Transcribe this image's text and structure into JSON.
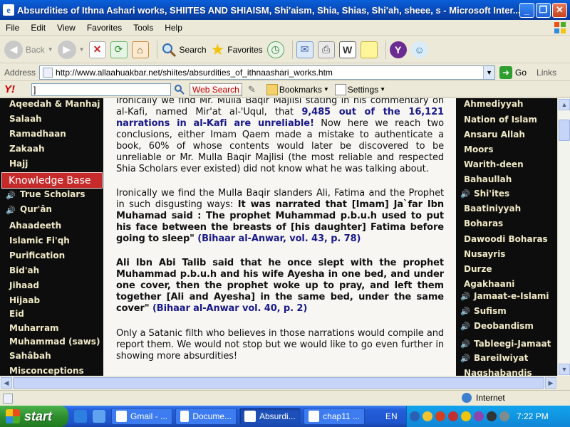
{
  "window": {
    "title": "Absurdities of Ithna Ashari works, SHIITES AND SHIAISM, Shi'aism, Shia, Shias, Shi'ah, sheee, s - Microsoft Inter..."
  },
  "menu": [
    "File",
    "Edit",
    "View",
    "Favorites",
    "Tools",
    "Help"
  ],
  "toolbar": {
    "back": "Back",
    "search": "Search",
    "favorites": "Favorites"
  },
  "address": {
    "label": "Address",
    "url": "http://www.allaahuakbar.net/shiites/absurdities_of_ithnaashari_works.htm",
    "go": "Go",
    "links": "Links"
  },
  "yahoo": {
    "logo": "Y!",
    "query": "]",
    "search_button": "Web Search",
    "bookmarks": "Bookmarks",
    "settings": "Settings"
  },
  "left_nav": [
    {
      "label": "Aqeedah & Manhaj",
      "sound": false
    },
    {
      "label": "Salaah",
      "sound": false
    },
    {
      "label": "Ramadhaan",
      "sound": false
    },
    {
      "label": "Zakaah",
      "sound": false
    },
    {
      "label": "Hajj",
      "sound": false
    },
    {
      "label": "Knowledge Base",
      "highlight": true
    },
    {
      "label": "True Scholars",
      "sound": true
    },
    {
      "label": "Qur'ân",
      "sound": true
    },
    {
      "label": "Ahaadeeth",
      "sound": false
    },
    {
      "label": "Islamic Fi'qh",
      "sound": false
    },
    {
      "label": "Purification",
      "sound": false
    },
    {
      "label": "Bid'ah",
      "sound": false
    },
    {
      "label": "Jihaad",
      "sound": false
    },
    {
      "label": "Hijaab",
      "sound": false
    },
    {
      "label": "Eid",
      "sound": false
    },
    {
      "label": "Muharram",
      "sound": false
    },
    {
      "label": "Muhammad (saws)",
      "sound": false
    },
    {
      "label": "Sahâbah",
      "sound": false
    },
    {
      "label": "Misconceptions",
      "sound": false
    }
  ],
  "right_nav": [
    {
      "label": "Ahmediyyah",
      "sound": false
    },
    {
      "label": "Nation of Islam",
      "sound": false
    },
    {
      "label": "Ansaru Allah",
      "sound": false
    },
    {
      "label": "Moors",
      "sound": false
    },
    {
      "label": "Warith-deen",
      "sound": false
    },
    {
      "label": "Bahaullah",
      "sound": false
    },
    {
      "label": "Shi'ites",
      "sound": true
    },
    {
      "label": "Baatiniyyah",
      "sound": false
    },
    {
      "label": "Boharas",
      "sound": false
    },
    {
      "label": "Dawoodi Boharas",
      "sound": false
    },
    {
      "label": "Nusayris",
      "sound": false
    },
    {
      "label": "Durze",
      "sound": false
    },
    {
      "label": "Agakhaani",
      "sound": false
    },
    {
      "label": "Jamaat-e-Islami",
      "sound": true
    },
    {
      "label": "Sufism",
      "sound": true
    },
    {
      "label": "Deobandism",
      "sound": true
    },
    {
      "label": "Tableegi-Jamaat",
      "sound": true
    },
    {
      "label": "Bareilwiyat",
      "sound": true
    },
    {
      "label": "Naqshabandis",
      "sound": false
    }
  ],
  "content": {
    "p1_a": "Ironically we find Mr. Mulla Baqir Majlisi stating in his commentary on al-Kafi, named Mir'at al-'Uqul, that ",
    "p1_b": "9,485 out of the 16,121 narrations in al-Kafi are unreliable!",
    "p1_c": " Now here we reach two conclusions, either Imam Qaem made a mistake to authenticate a book, 60% of whose contents would later be discovered to be unreliable or Mr. Mulla Baqir Majlisi (the most reliable and respected Shia Scholars ever existed) did not know what he was talking about.",
    "p2_a": "Ironically we find the Mulla Baqir slanders Ali, Fatima and the Prophet in such disgusting ways: ",
    "p2_b": "It was narrated that [Imam] Ja`far Ibn Muhamad said : The prophet Muhammad p.b.u.h used to put his face between the breasts of [his daughter] Fatima before going to sleep\"",
    "p2_c": " (Bihaar al-Anwar, vol. 43, p. 78)",
    "p3_a": "Ali Ibn Abi Talib said that he once slept with the prophet Muhammad p.b.u.h and his wife Ayesha in one bed, and under one cover, then the prophet woke up to pray, and left them together [Ali and Ayesha] in the same bed, under the same cover\"",
    "p3_b": " (Bihaar al-Anwar vol. 40, p. 2)",
    "p4": "Only a Satanic filth who believes in those narrations would compile and report them. We would not stop but we would like to go even further in showing more absurdities!"
  },
  "status": {
    "zone": "Internet"
  },
  "taskbar": {
    "start": "start",
    "tasks": [
      "Gmail - ...",
      "Docume...",
      "Absurdi...",
      "chap11 ..."
    ],
    "lang": "EN",
    "clock": "7:22 PM"
  }
}
